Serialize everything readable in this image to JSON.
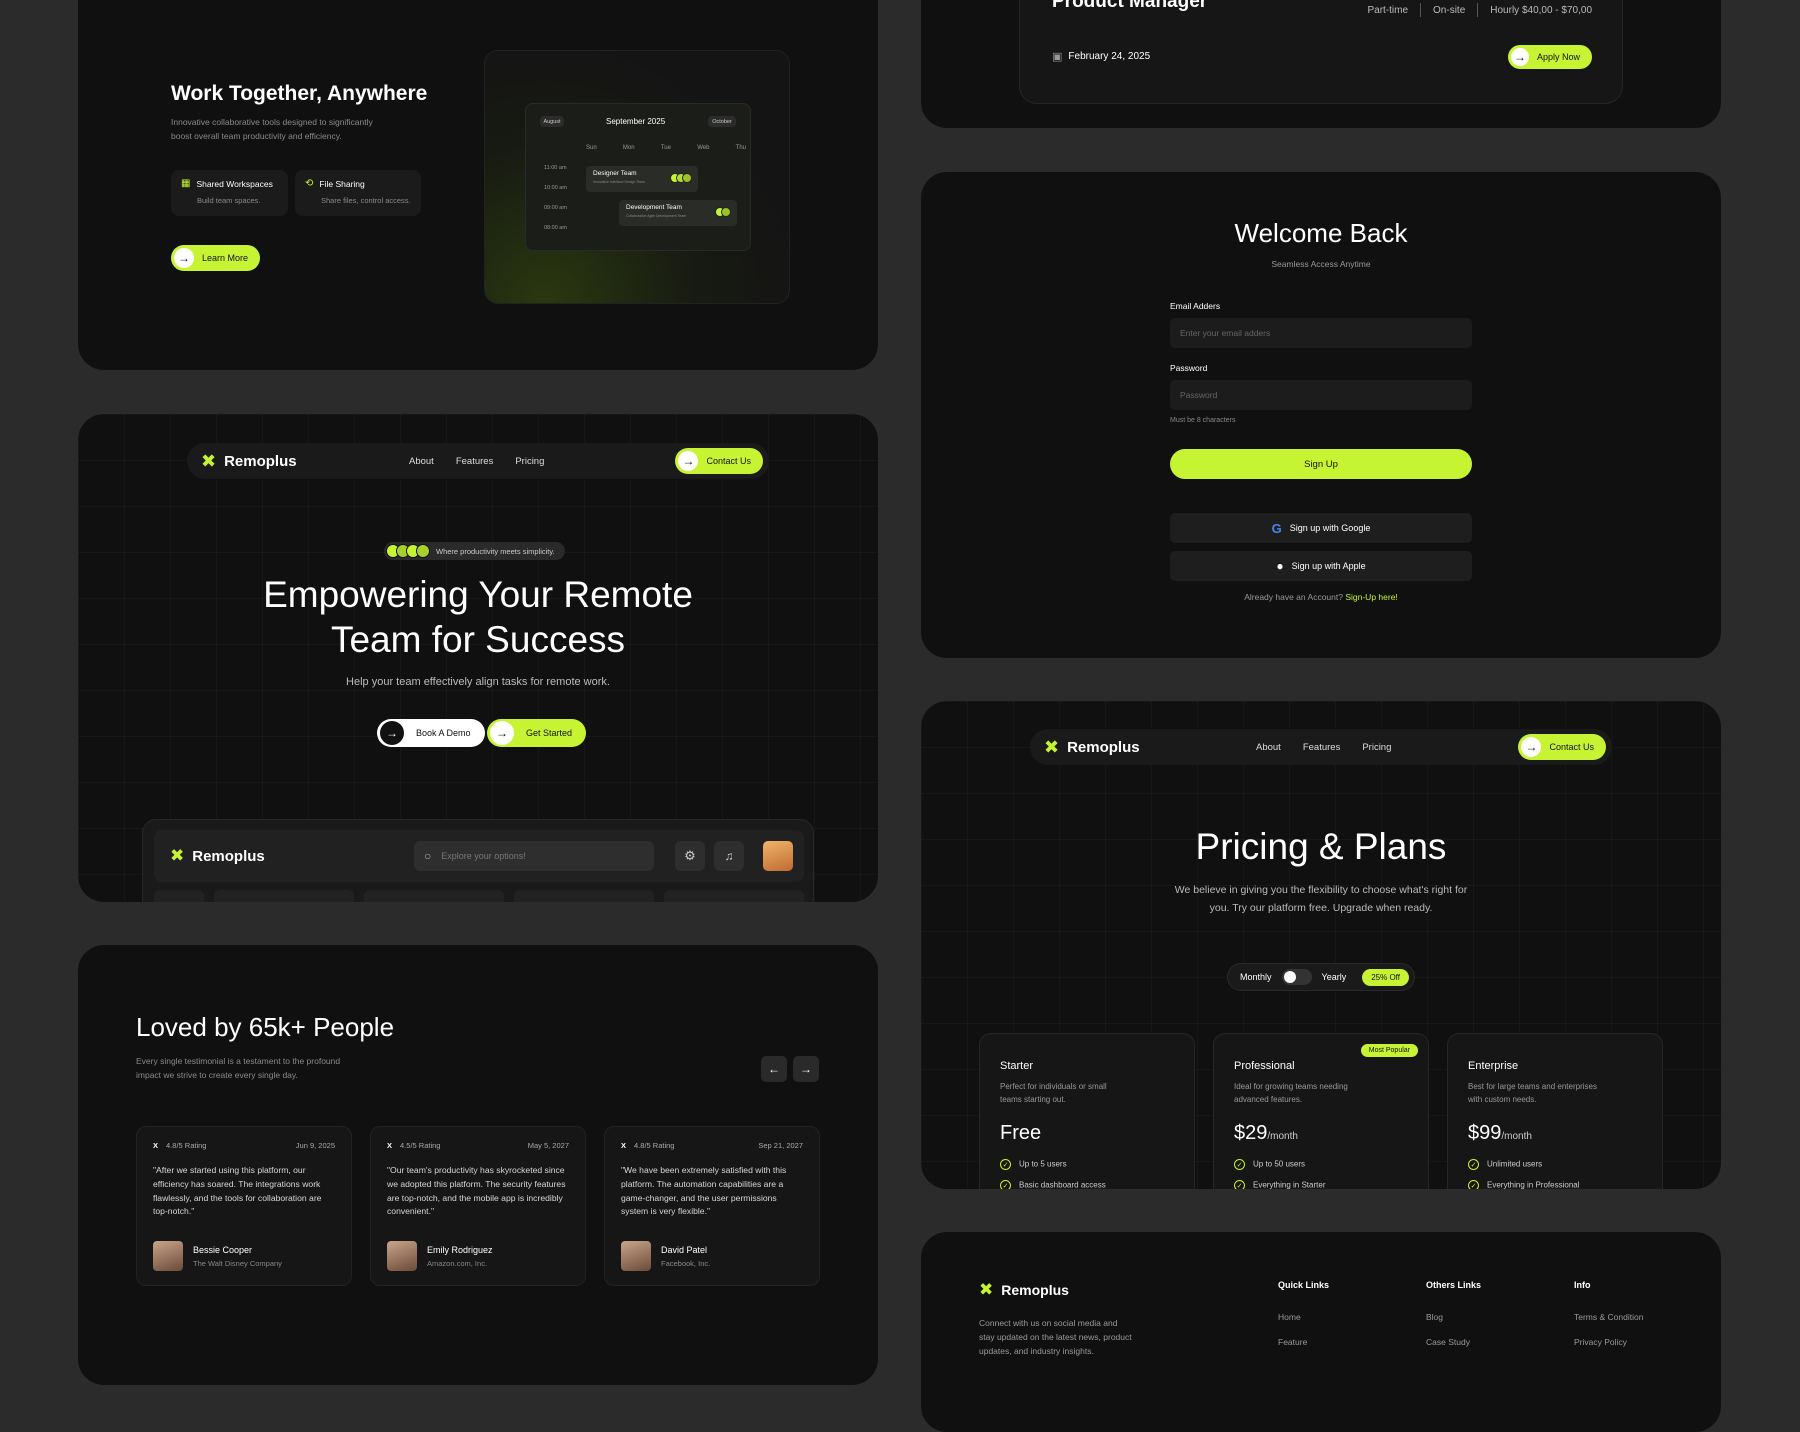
{
  "work": {
    "title": "Work Together, Anywhere",
    "desc1": "Innovative collaborative tools designed to significantly",
    "desc2": "boost overall team productivity and efficiency.",
    "features": [
      {
        "title": "Shared Workspaces",
        "sub": "Build team spaces."
      },
      {
        "title": "File Sharing",
        "sub": "Share files, control access."
      }
    ],
    "learn_more": "Learn More",
    "calendar": {
      "prev": "August",
      "month": "September 2025",
      "next": "October",
      "days": [
        "Sun",
        "Mon",
        "Tue",
        "Web",
        "Thu"
      ],
      "times": [
        "11:00 am",
        "10:00 am",
        "09:00 am",
        "08:00 am"
      ],
      "events": [
        {
          "title": "Designer Team",
          "sub": "Innovative Interface Design Team"
        },
        {
          "title": "Development Team",
          "sub": "Collaborative Agile Development Team"
        }
      ]
    }
  },
  "job": {
    "title": "Product Manager",
    "tags": [
      "Part-time",
      "On-site",
      "Hourly $40,00 - $70,00"
    ],
    "date": "February 24, 2025",
    "apply": "Apply Now"
  },
  "hero": {
    "brand": "Remoplus",
    "nav": [
      "About",
      "Features",
      "Pricing"
    ],
    "contact": "Contact Us",
    "badge": "Where productivity meets simplicity.",
    "line1": "Empowering Your Remote",
    "line2": "Team for Success",
    "sub": "Help your team effectively align tasks for remote work.",
    "demo": "Book A Demo",
    "start": "Get Started",
    "app_brand": "Remoplus",
    "search_placeholder": "Explore your options!"
  },
  "login": {
    "title": "Welcome Back",
    "sub": "Seamless Access Anytime",
    "email_label": "Email Adders",
    "email_placeholder": "Enter your email adders",
    "password_label": "Password",
    "password_placeholder": "Password",
    "hint": "Must be 8 characters",
    "signup": "Sign Up",
    "google": "Sign up with Google",
    "apple": "Sign up with Apple",
    "have_account": "Already have an Account?",
    "signup_link": "Sign-Up here!"
  },
  "testimonials": {
    "title": "Loved by 65k+ People",
    "desc1": "Every single testimonial is a testament to the profound",
    "desc2": "impact we strive to create every single day.",
    "items": [
      {
        "rating": "4.8/5 Rating",
        "date": "Jun 9, 2025",
        "quote": "\"After we started using this platform, our efficiency has soared. The integrations work flawlessly, and the tools for collaboration are top-notch.\"",
        "name": "Bessie Cooper",
        "company": "The Walt Disney Company"
      },
      {
        "rating": "4.5/5 Rating",
        "date": "May 5, 2027",
        "quote": "\"Our team's productivity has skyrocketed since we adopted this platform. The security features are top-notch, and the mobile app is incredibly convenient.\"",
        "name": "Emily Rodriguez",
        "company": "Amazon.com, Inc."
      },
      {
        "rating": "4.8/5 Rating",
        "date": "Sep 21, 2027",
        "quote": "\"We have been extremely satisfied with this platform. The automation capabilities are a game-changer, and the user permissions system is very flexible.\"",
        "name": "David Patel",
        "company": "Facebook, Inc."
      }
    ]
  },
  "pricing": {
    "brand": "Remoplus",
    "nav": [
      "About",
      "Features",
      "Pricing"
    ],
    "contact": "Contact Us",
    "title": "Pricing & Plans",
    "sub1": "We believe in giving you the flexibility to choose what's right for",
    "sub2": "you. Try our platform free. Upgrade when ready.",
    "monthly": "Monthly",
    "yearly": "Yearly",
    "discount": "25% Off",
    "plans": [
      {
        "name": "Starter",
        "desc1": "Perfect for individuals or small",
        "desc2": "teams starting out.",
        "price": "Free",
        "per": "",
        "feature": "Up to 5 users",
        "feature2": "Basic dashboard access",
        "badge": ""
      },
      {
        "name": "Professional",
        "desc1": "Ideal for growing teams needing",
        "desc2": "advanced features.",
        "price": "$29",
        "per": "/month",
        "feature": "Up to 50 users",
        "feature2": "Everything in Starter",
        "badge": "Most Popular"
      },
      {
        "name": "Enterprise",
        "desc1": "Best for large teams and enterprises",
        "desc2": "with custom needs.",
        "price": "$99",
        "per": "/month",
        "feature": "Unlimited users",
        "feature2": "Everything in Professional",
        "badge": ""
      }
    ]
  },
  "footer": {
    "brand": "Remoplus",
    "desc1": "Connect with us on social media and",
    "desc2": "stay updated on the latest news, product",
    "desc3": "updates, and industry insights.",
    "cols": [
      {
        "title": "Quick Links",
        "links": [
          "Home",
          "Feature"
        ]
      },
      {
        "title": "Others Links",
        "links": [
          "Blog",
          "Case Study"
        ]
      },
      {
        "title": "Info",
        "links": [
          "Terms & Condition",
          "Privacy Policy"
        ]
      }
    ]
  },
  "colors": {
    "accent": "#c6f432",
    "background": "#2b2b2b",
    "card": "#101010"
  }
}
